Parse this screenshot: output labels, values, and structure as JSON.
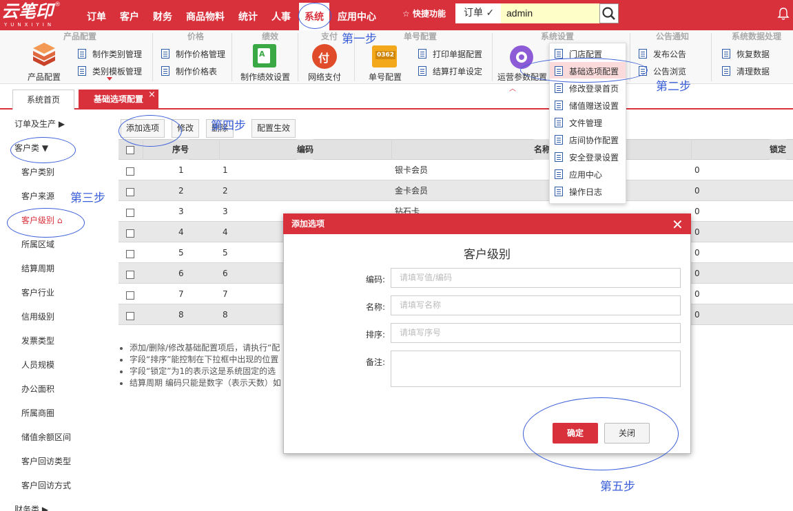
{
  "app": {
    "logo_text": "云笔印",
    "logo_sub": "YUNXIYIN",
    "logo_reg": "®"
  },
  "nav": {
    "items": [
      "订单",
      "客户",
      "财务",
      "商品物料",
      "统计",
      "人事",
      "系统",
      "应用中心"
    ],
    "active": "系统"
  },
  "topbar": {
    "quick_label": "快捷功能",
    "order_select": "订单",
    "search_value": "admin"
  },
  "ribbon": {
    "groups": [
      "产品配置",
      "价格",
      "绩效",
      "支付",
      "单号配置",
      "系统设置",
      "公告通知",
      "系统数据处理"
    ],
    "product": {
      "big": "产品配置",
      "items": [
        "制作类别管理",
        "类别模板管理"
      ]
    },
    "price": {
      "items": [
        "制作价格管理",
        "制作价格表"
      ]
    },
    "perf": {
      "big": "制作绩效设置"
    },
    "pay": {
      "big": "网络支付"
    },
    "number": {
      "big": "单号配置",
      "big_icon_text": "0362",
      "items": [
        "打印单据配置",
        "结算打单设定"
      ]
    },
    "sys": {
      "big": "运营参数配置"
    },
    "notice": {
      "items": [
        "发布公告",
        "公告浏览"
      ]
    },
    "data": {
      "items": [
        "恢复数据",
        "清理数据"
      ]
    }
  },
  "dropdown": {
    "items": [
      "门店配置",
      "基础选项配置",
      "修改登录首页",
      "储值赠送设置",
      "文件管理",
      "店间协作配置",
      "安全登录设置",
      "应用中心",
      "操作日志"
    ],
    "selected": "基础选项配置"
  },
  "tabs": {
    "home": "系统首页",
    "current": "基础选项配置",
    "close": "×"
  },
  "sidebar": {
    "head1": "订单及生产",
    "head2": "客户类",
    "items": [
      "客户类别",
      "客户来源",
      "客户级别",
      "所属区域",
      "结算周期",
      "客户行业",
      "信用级别",
      "发票类型",
      "人员规模",
      "办公面积",
      "所属商圈",
      "储值余额区间",
      "客户回访类型",
      "客户回访方式"
    ],
    "active": "客户级别",
    "head3": "财务类"
  },
  "toolbar": {
    "add": "添加选项",
    "edit": "修改",
    "delete": "删除",
    "apply": "配置生效"
  },
  "table": {
    "headers": [
      "序号",
      "编码",
      "名称",
      "锁定"
    ],
    "rows": [
      {
        "seq": "1",
        "code": "1",
        "name": "银卡会员",
        "lock": "0"
      },
      {
        "seq": "2",
        "code": "2",
        "name": "金卡会员",
        "lock": "0"
      },
      {
        "seq": "3",
        "code": "3",
        "name": "钻石卡",
        "lock": "0"
      },
      {
        "seq": "4",
        "code": "4",
        "name": "",
        "lock": "0"
      },
      {
        "seq": "5",
        "code": "5",
        "name": "",
        "lock": "0"
      },
      {
        "seq": "6",
        "code": "6",
        "name": "",
        "lock": "0"
      },
      {
        "seq": "7",
        "code": "7",
        "name": "",
        "lock": "0"
      },
      {
        "seq": "8",
        "code": "8",
        "name": "",
        "lock": "0"
      }
    ]
  },
  "notes": [
    "添加/删除/修改基础配置项后，请执行“配",
    "字段“排序”能控制在下拉框中出现的位置",
    "字段“锁定”为1的表示这是系统固定的选",
    "结算周期 编码只能是数字（表示天数）如"
  ],
  "modal": {
    "header": "添加选项",
    "title": "客户级别",
    "fields": [
      {
        "label": "编码:",
        "placeholder": "请填写值/编码"
      },
      {
        "label": "名称:",
        "placeholder": "请填写名称"
      },
      {
        "label": "排序:",
        "placeholder": "请填写序号"
      },
      {
        "label": "备注:",
        "placeholder": ""
      }
    ],
    "ok": "确定",
    "close": "关闭"
  },
  "annotations": {
    "step1": "第一步",
    "step2": "第二步",
    "step3": "第三步",
    "step4": "第四步",
    "step5": "第五步"
  },
  "colors": {
    "brand_red": "#d9313c",
    "annotation_blue": "#3b5fd9",
    "search_bg": "#fefec8"
  }
}
